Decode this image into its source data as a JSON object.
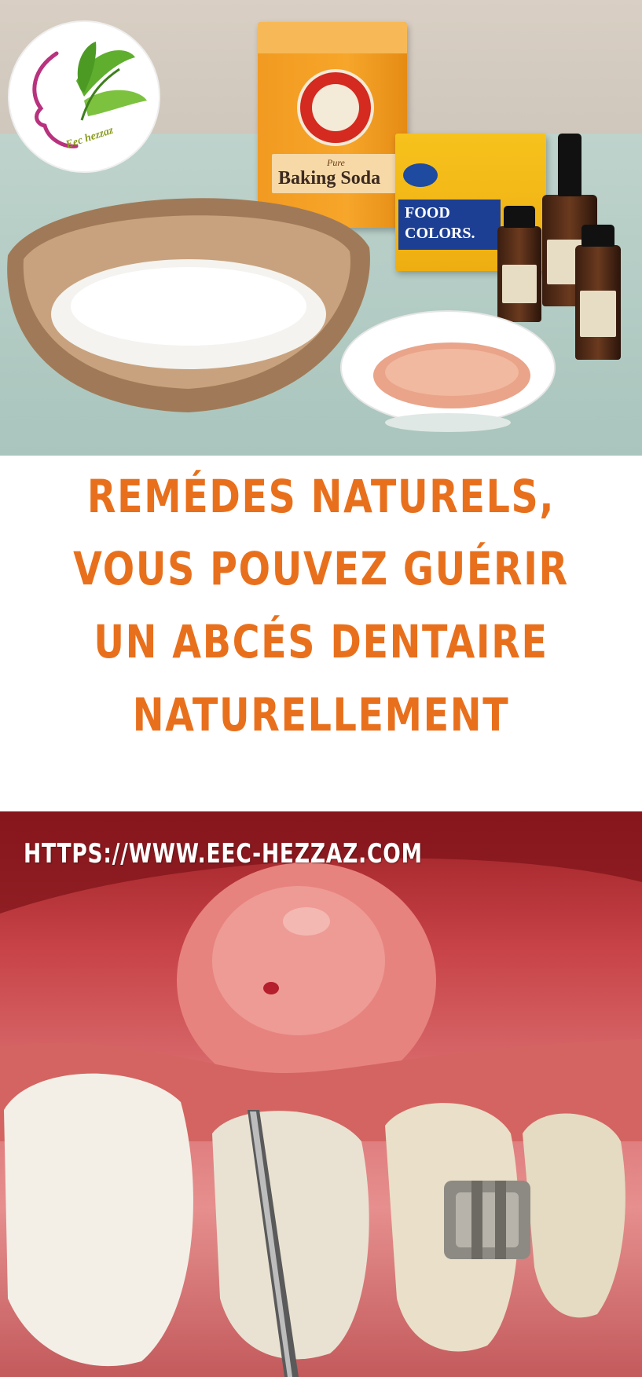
{
  "top_photo": {
    "logo": {
      "text": "Eec hezzaz",
      "accent_green": "#5fae2e",
      "accent_magenta": "#b8327e"
    },
    "baking_soda_box": {
      "pure_label": "Pure",
      "name_label": "Baking Soda"
    },
    "food_colors_box": {
      "line1": "FOOD",
      "line2": "COLORS."
    }
  },
  "title": {
    "line1": "REMÉDES NATURELS,",
    "line2": "VOUS POUVEZ GUÉRIR",
    "line3": "UN ABCÉS DENTAIRE",
    "line4": "NATURELLEMENT",
    "color": "#e8701c"
  },
  "bottom_photo": {
    "url": "HTTPS://WWW.EEC-HEZZAZ.COM"
  }
}
